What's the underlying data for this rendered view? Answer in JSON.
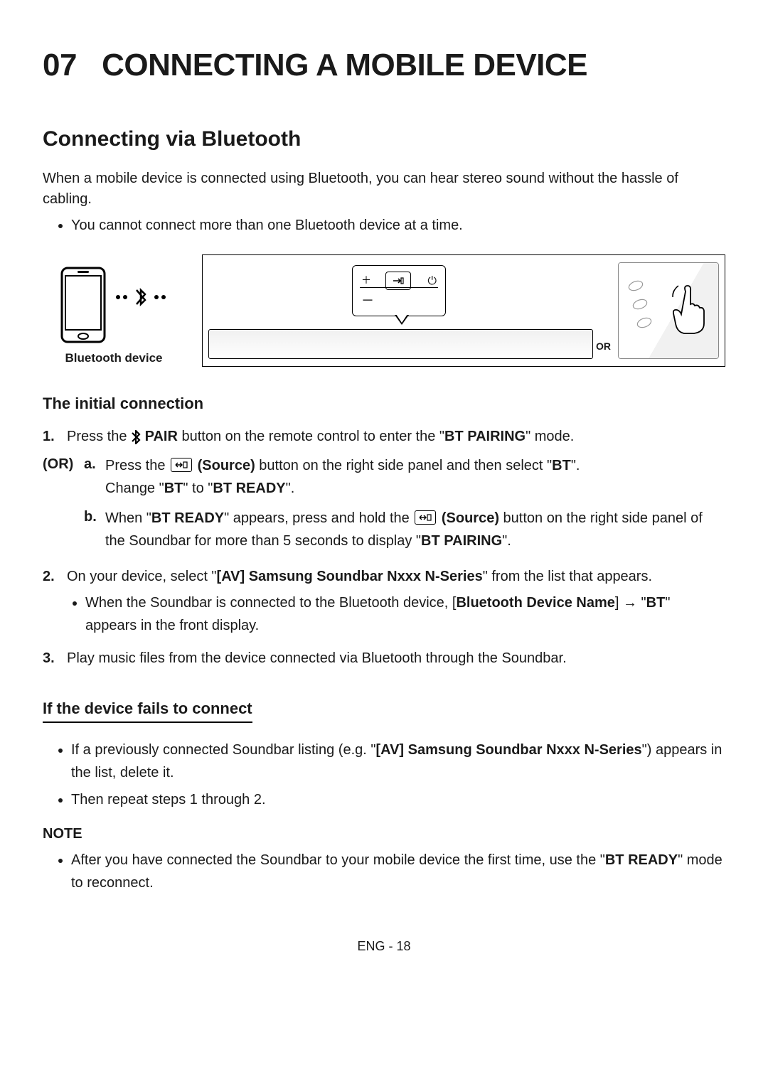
{
  "chapter": {
    "number": "07",
    "title": "CONNECTING A MOBILE DEVICE"
  },
  "section_title": "Connecting via Bluetooth",
  "intro": "When a mobile device is connected using Bluetooth, you can hear stereo sound without the hassle of cabling.",
  "intro_bullet": "You cannot connect more than one Bluetooth device at a time.",
  "diagram": {
    "bt_device_label": "Bluetooth device",
    "or_label": "OR"
  },
  "initial": {
    "heading": "The initial connection",
    "step1_num": "1.",
    "step1_pre": "Press the ",
    "step1_pair": " PAIR",
    "step1_post": " button on the remote control to enter the \"",
    "step1_mode": "BT PAIRING",
    "step1_end": "\" mode.",
    "or_tag": "(OR)",
    "a_let": "a.",
    "a_pre": "Press the ",
    "a_source": " (Source)",
    "a_mid": " button on the right side panel and then select \"",
    "a_bt": "BT",
    "a_after_bt": "\".",
    "a_line2_pre": "Change \"",
    "a_line2_bt": "BT",
    "a_line2_mid": "\" to \"",
    "a_line2_ready": "BT READY",
    "a_line2_end": "\".",
    "b_let": "b.",
    "b_pre": "When \"",
    "b_ready": "BT READY",
    "b_mid1": "\" appears, press and hold the ",
    "b_source": " (Source)",
    "b_mid2": " button on the right side panel of the Soundbar for more than 5 seconds to display \"",
    "b_pairing": "BT PAIRING",
    "b_end": "\".",
    "step2_num": "2.",
    "step2_pre": "On your device, select \"",
    "step2_name": "[AV] Samsung Soundbar Nxxx N-Series",
    "step2_post": "\" from the list that appears.",
    "step2_sub_pre": "When the Soundbar is connected to the Bluetooth device, [",
    "step2_sub_name": "Bluetooth Device Name",
    "step2_sub_mid": "] → \"",
    "step2_sub_bt": "BT",
    "step2_sub_end": "\" appears in the front display.",
    "step3_num": "3.",
    "step3_text": "Play music files from the device connected via Bluetooth through the Soundbar."
  },
  "fail": {
    "heading": "If the device fails to connect",
    "b1_pre": "If a previously connected Soundbar listing (e.g. \"",
    "b1_name": "[AV] Samsung Soundbar Nxxx N-Series",
    "b1_post": "\") appears in the list, delete it.",
    "b2": "Then repeat steps 1 through 2."
  },
  "note": {
    "head": "NOTE",
    "b1_pre": "After you have connected the Soundbar to your mobile device the first time, use the \"",
    "b1_ready": "BT READY",
    "b1_post": "\" mode to reconnect."
  },
  "footer": "ENG - 18"
}
